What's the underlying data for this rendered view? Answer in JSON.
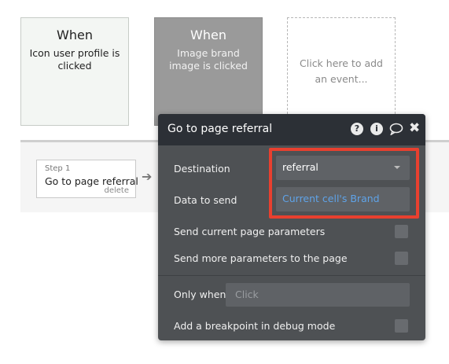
{
  "events": [
    {
      "when": "When",
      "description": "Icon user profile is clicked"
    },
    {
      "when": "When",
      "description": "Image brand image is clicked"
    },
    {
      "description": "Click here to add an event..."
    }
  ],
  "workflow": {
    "step_number": "Step 1",
    "step_title": "Go to page referral",
    "delete_label": "delete",
    "arrow": "➔"
  },
  "panel": {
    "title": "Go to page referral",
    "icons": [
      "help-icon",
      "info-icon",
      "comment-icon",
      "close-icon"
    ],
    "help_glyph": "?",
    "info_glyph": "i",
    "close_glyph": "✖",
    "destination": {
      "label": "Destination",
      "value": "referral"
    },
    "data_to_send": {
      "label": "Data to send",
      "value": "Current cell's Brand"
    },
    "send_current_params": {
      "label": "Send current page parameters",
      "checked": false
    },
    "send_more_params": {
      "label": "Send more parameters to the page",
      "checked": false
    },
    "only_when": {
      "label": "Only when",
      "placeholder": "Click"
    },
    "breakpoint": {
      "label": "Add a breakpoint in debug mode",
      "checked": false
    }
  },
  "colors": {
    "highlight": "#e8402f",
    "panel_bg": "#4e5154",
    "panel_header": "#2c3036",
    "link_blue": "#5fa3e8"
  }
}
